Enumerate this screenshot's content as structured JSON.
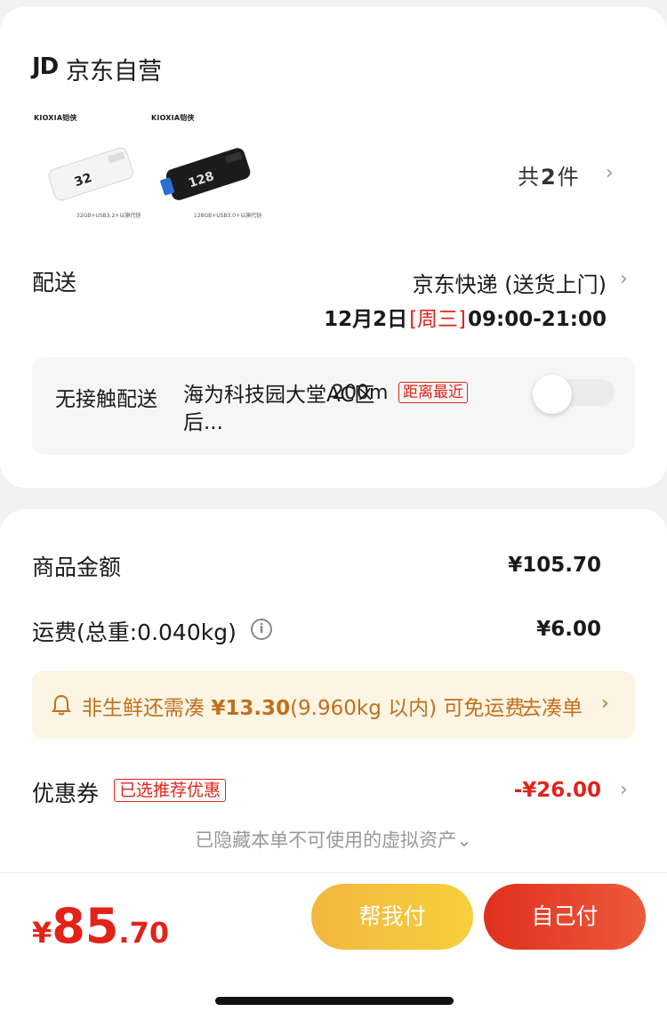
{
  "store": {
    "logo": "JD",
    "name": "京东自营"
  },
  "products": [
    {
      "brand": "KIOXIA铠侠",
      "capacity": "32",
      "caption": "32GB+USB3.2+以旗代铠",
      "color": "white"
    },
    {
      "brand": "KIOXIA铠侠",
      "capacity": "128",
      "caption": "128GB+USB3.0+以旗代铠",
      "color": "black"
    }
  ],
  "item_count": {
    "prefix": "共",
    "count": "2",
    "suffix": "件"
  },
  "delivery": {
    "label": "配送",
    "method": "京东快递 (送货上门)",
    "date": "12月2日",
    "weekday": "[周三]",
    "time_range": "09:00-21:00"
  },
  "contactless": {
    "label": "无接触配送",
    "place": "海为科技园大堂AC区后...",
    "distance": "200m",
    "tag": "距离最近",
    "toggle_on": false
  },
  "summary": {
    "goods_label": "商品金额",
    "goods_amount": "¥105.70",
    "shipping_label": "运费(总重:0.040kg)",
    "shipping_amount": "¥6.00",
    "info_icon": "i"
  },
  "notice": {
    "text_pre": "非生鲜还需凑",
    "amount": "¥13.30",
    "text_post": "(9.960kg 以内) 可免运费",
    "link": "去凑单"
  },
  "coupon": {
    "label": "优惠券",
    "tag": "已选推荐优惠",
    "amount": "-¥26.00"
  },
  "hidden_assets": "已隐藏本单不可使用的虚拟资产⌄",
  "footer": {
    "currency": "¥",
    "price_int": "85",
    "price_dec": ".70",
    "help_pay": "帮我付",
    "self_pay": "自己付"
  },
  "colors": {
    "accent_red": "#e2231a",
    "notice_text": "#c0701e",
    "notice_bg": "#fdf5e3",
    "help_btn": "#f5c23c",
    "self_btn": "#e63e25"
  }
}
